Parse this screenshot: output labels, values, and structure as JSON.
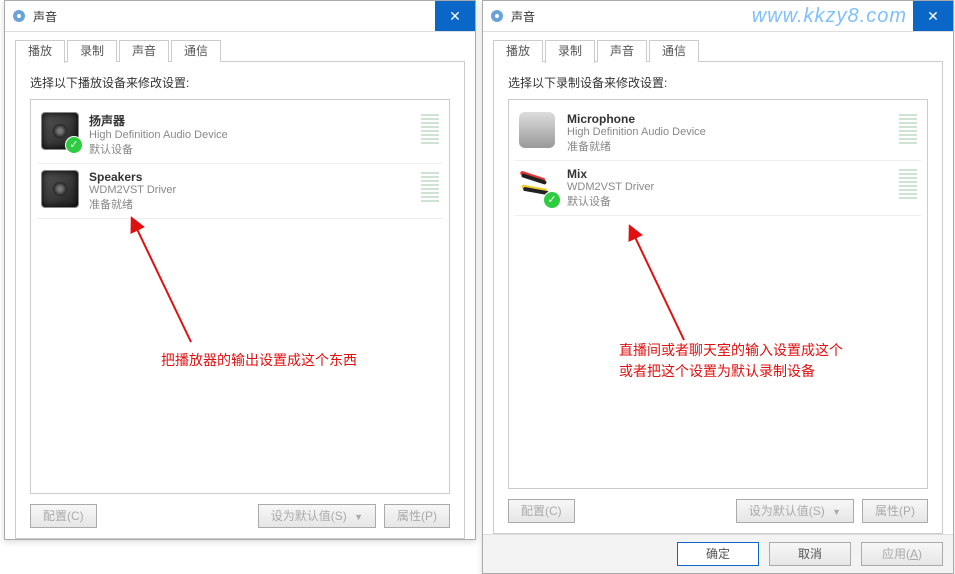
{
  "watermark": "www.kkzy8.com",
  "left_dialog": {
    "title": "声音",
    "tabs": [
      "播放",
      "录制",
      "声音",
      "通信"
    ],
    "active_tab": 0,
    "panel_label": "选择以下播放设备来修改设置:",
    "devices": [
      {
        "name": "扬声器",
        "driver": "High Definition Audio Device",
        "status": "默认设备",
        "icon": "speaker",
        "default": true
      },
      {
        "name": "Speakers",
        "driver": "WDM2VST Driver",
        "status": "准备就绪",
        "icon": "speaker",
        "default": false
      }
    ],
    "annotation": "把播放器的输出设置成这个东西",
    "buttons": {
      "configure": "配置(C)",
      "set_default": "设为默认值(S)",
      "properties": "属性(P)"
    }
  },
  "right_dialog": {
    "title": "声音",
    "tabs": [
      "播放",
      "录制",
      "声音",
      "通信"
    ],
    "active_tab": 1,
    "panel_label": "选择以下录制设备来修改设置:",
    "devices": [
      {
        "name": "Microphone",
        "driver": "High Definition Audio Device",
        "status": "准备就绪",
        "icon": "mic",
        "default": false
      },
      {
        "name": "Mix",
        "driver": "WDM2VST Driver",
        "status": "默认设备",
        "icon": "mix",
        "default": true
      }
    ],
    "annotation_line1": "直播间或者聊天室的输入设置成这个",
    "annotation_line2": "或者把这个设置为默认录制设备",
    "buttons": {
      "configure": "配置(C)",
      "set_default": "设为默认值(S)",
      "properties": "属性(P)"
    },
    "dialog_buttons": {
      "ok": "确定",
      "cancel": "取消",
      "apply": "应用(A)"
    }
  }
}
